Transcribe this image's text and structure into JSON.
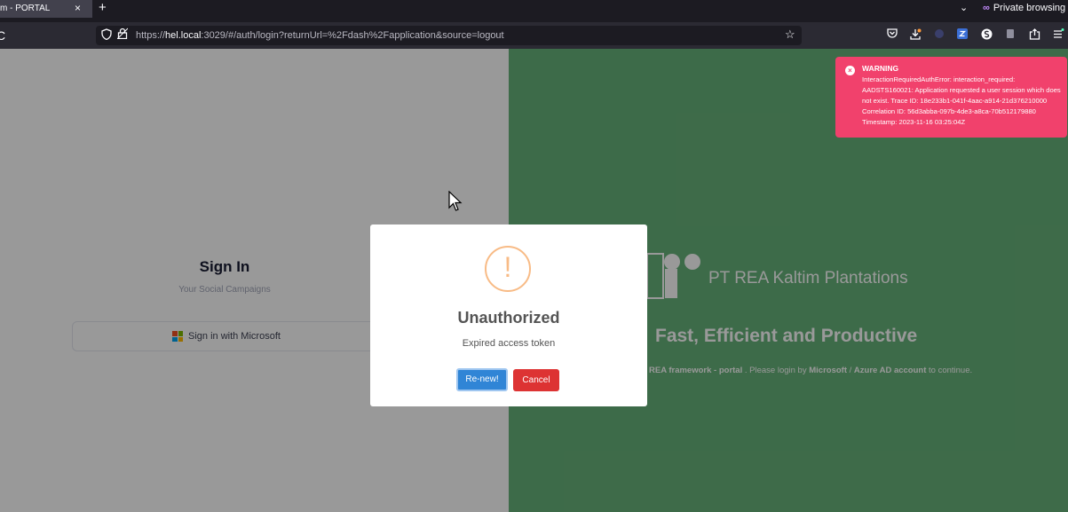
{
  "browser": {
    "tab_title": "m - PORTAL",
    "tab_close": "×",
    "new_tab": "+",
    "tab_list": "⌄",
    "private_icon": "∞",
    "private_label": "Private browsing",
    "reload": "C",
    "url_prefix": "https://",
    "url_host": "hel.local",
    "url_rest": ":3029/#/auth/login?returnUrl=%2Fdash%2Fapplication&source=logout",
    "star": "☆"
  },
  "signin": {
    "title": "Sign In",
    "subtitle": "Your Social Campaigns",
    "microsoft_button": "Sign in with Microsoft"
  },
  "brand": {
    "name": "PT REA Kaltim Plantations",
    "tagline": "Fast, Efficient and Productive",
    "desc_part1": "REA framework - portal",
    "desc_part2": " . Please login by ",
    "desc_part3": "Microsoft",
    "desc_part4": " / ",
    "desc_part5": "Azure AD account",
    "desc_part6": " to continue."
  },
  "modal": {
    "icon": "!",
    "title": "Unauthorized",
    "text": "Expired access token",
    "renew_label": "Re-new!",
    "cancel_label": "Cancel"
  },
  "toast": {
    "icon": "×",
    "title": "WARNING",
    "body": "InteractionRequiredAuthError: interaction_required: AADSTS160021: Application requested a user session which does not exist. Trace ID: 18e233b1-041f-4aac-a914-21d376210000 Correlation ID: 56d3abba-097b-4de3-a8ca-70b512179880 Timestamp: 2023-11-16 03:25:04Z"
  },
  "colors": {
    "right_panel": "#67b37a",
    "toast": "#f1416c",
    "renew": "#3085d6",
    "cancel": "#dd3333"
  }
}
